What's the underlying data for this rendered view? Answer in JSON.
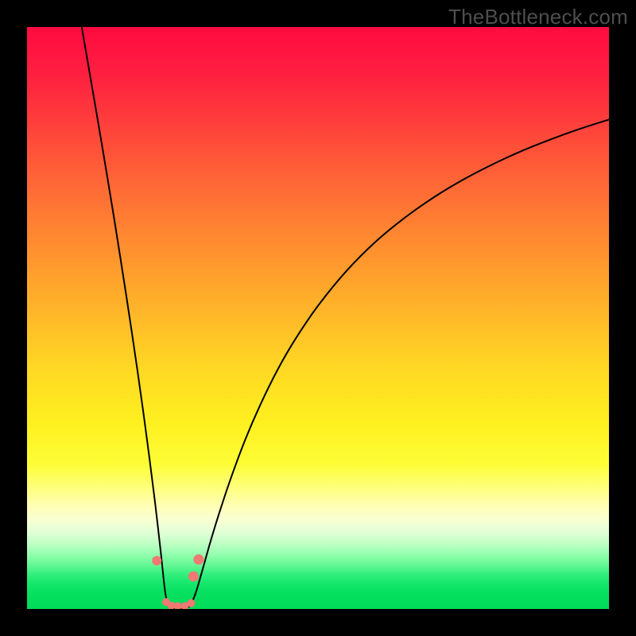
{
  "watermark": "TheBottleneck.com",
  "colors": {
    "frame": "#000000",
    "curve": "#000000",
    "marker": "#ee7a73"
  },
  "chart_data": {
    "type": "line",
    "title": "",
    "xlabel": "",
    "ylabel": "",
    "xlim": [
      0,
      100
    ],
    "ylim": [
      0,
      100
    ],
    "grid": false,
    "note": "Axes are unlabeled in the source image; values are estimated on a 0–100 normalized scale from pixel positions.",
    "series": [
      {
        "name": "left-branch",
        "x": [
          9.4,
          11,
          12,
          13,
          14,
          15,
          16,
          17,
          18,
          19,
          20,
          21,
          22,
          23,
          23.8,
          24.5,
          25.1,
          25.7,
          26.2
        ],
        "y": [
          100,
          90.7,
          84.9,
          79.0,
          73.0,
          66.9,
          60.6,
          54.2,
          47.6,
          40.8,
          33.7,
          26.2,
          18.3,
          9.6,
          2.5,
          0.7,
          0.14,
          0.02,
          0
        ]
      },
      {
        "name": "right-branch",
        "x": [
          26.2,
          26.8,
          27.4,
          28.1,
          29,
          30,
          31.5,
          33,
          35,
          37.5,
          40,
          43,
          46,
          50,
          55,
          60,
          65,
          70,
          75,
          80,
          85,
          90,
          95,
          100
        ],
        "y": [
          0,
          0.02,
          0.14,
          0.7,
          2.8,
          6.2,
          11.5,
          16.4,
          22.4,
          29.1,
          34.9,
          41.0,
          46.2,
          52.1,
          58.2,
          63.2,
          67.3,
          70.8,
          73.8,
          76.4,
          78.7,
          80.7,
          82.5,
          84.1
        ]
      }
    ],
    "markers": {
      "name": "highlight-points",
      "x": [
        22.3,
        23.9,
        24.8,
        25.9,
        27.1,
        28.2,
        28.6,
        29.5
      ],
      "y": [
        8.3,
        1.2,
        0.6,
        0.5,
        0.5,
        1.0,
        5.6,
        8.5
      ],
      "r": [
        6.0,
        5.0,
        5.0,
        5.0,
        5.0,
        5.0,
        6.5,
        6.5
      ]
    }
  }
}
